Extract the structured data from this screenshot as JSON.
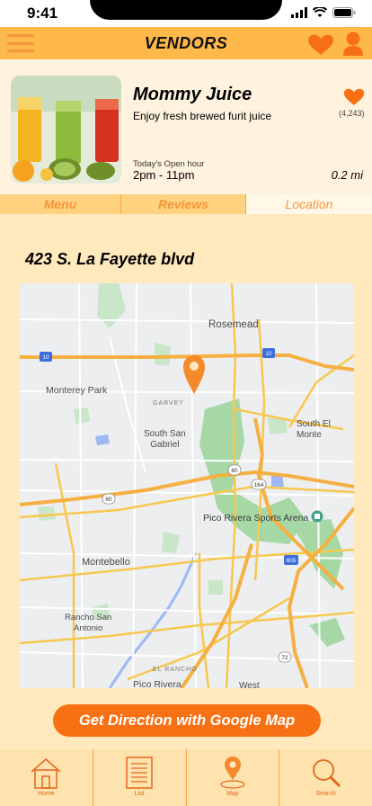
{
  "status": {
    "time": "9:41"
  },
  "header": {
    "title": "VENDORS",
    "menu_icon": "hamburger-icon",
    "favorites_icon": "heart-icon",
    "profile_icon": "user-icon"
  },
  "vendor": {
    "name": "Mommy Juice",
    "description": "Enjoy fresh brewed furit juice",
    "favorite_count": "(4,243)",
    "open_label": "Today's Open hour",
    "open_hours": "2pm - 11pm",
    "distance": "0.2 mi"
  },
  "tabs": [
    {
      "label": "Menu"
    },
    {
      "label": "Reviews"
    },
    {
      "label": "Location",
      "active": true
    }
  ],
  "location": {
    "address": "423 S. La Fayette blvd",
    "map_labels": {
      "rosemead": "Rosemead",
      "monterey_park": "Monterey Park",
      "garvey": "GARVEY",
      "south_san_gabriel": "South San\nGabriel",
      "south_el_monte": "South El\nMonte",
      "pico_rivera_sports": "Pico Rivera Sports Arena",
      "montebello": "Montebello",
      "rancho_san_antonio": "Rancho San\nAntonio",
      "el_rancho": "EL RANCHO",
      "pico_rivera": "Pico Rivera",
      "west": "West"
    },
    "highway_shields": [
      "10",
      "10",
      "60",
      "164",
      "60",
      "605",
      "72"
    ],
    "direction_button": "Get Direction with Google Map"
  },
  "bottom_nav": [
    {
      "label": "Home",
      "icon": "home-icon"
    },
    {
      "label": "List",
      "icon": "list-icon"
    },
    {
      "label": "Map",
      "icon": "map-pin-icon"
    },
    {
      "label": "Search",
      "icon": "search-icon"
    }
  ],
  "colors": {
    "accent": "#F87014",
    "header": "#FFB84A",
    "background": "#FFE9BD"
  }
}
